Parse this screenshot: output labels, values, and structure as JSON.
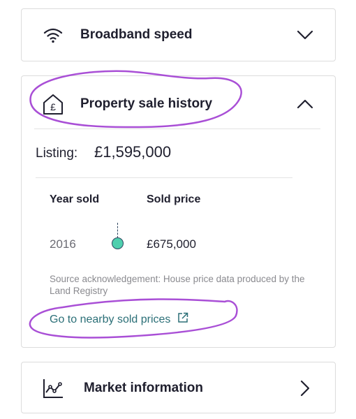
{
  "broadband": {
    "title": "Broadband speed",
    "icon": "wifi-icon",
    "toggle_icon": "chevron-down-icon"
  },
  "history": {
    "title": "Property sale history",
    "icon": "pound-house-icon",
    "toggle_icon": "chevron-up-icon",
    "listing_label": "Listing:",
    "listing_value": "£1,595,000",
    "columns": {
      "year": "Year sold",
      "price": "Sold price"
    },
    "rows": [
      {
        "year": "2016",
        "price": "£675,000"
      }
    ],
    "source": "Source acknowledgement: House price data produced by the Land Registry",
    "link_label": "Go to nearby sold prices",
    "link_icon": "external-link-icon"
  },
  "market": {
    "title": "Market information",
    "icon": "line-chart-icon",
    "toggle_icon": "chevron-right-icon"
  },
  "colors": {
    "text": "#1f1f2e",
    "muted": "#6b6b73",
    "link": "#2b6f77",
    "timeline_dot": "#4fcfae",
    "annotation": "#a94fd6"
  }
}
